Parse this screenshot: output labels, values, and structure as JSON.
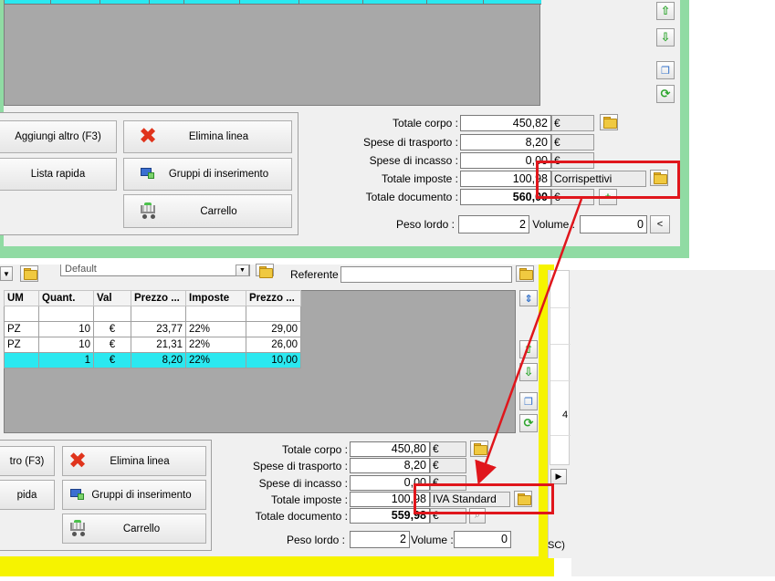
{
  "top": {
    "buttons": {
      "add_other": "Aggiungi altro (F3)",
      "quick_list": "Lista rapida",
      "delete_line": "Elimina linea",
      "insert_groups": "Gruppi di inserimento",
      "cart": "Carrello"
    },
    "totals": {
      "body_label": "Totale corpo :",
      "body_value": "450,82",
      "transport_label": "Spese di trasporto :",
      "transport_value": "8,20",
      "collection_label": "Spese di incasso :",
      "collection_value": "0,00",
      "taxes_label": "Totale imposte :",
      "taxes_value": "100,98",
      "tax_regime": "Corrispettivi",
      "doc_label": "Totale documento :",
      "doc_value": "560,00",
      "currency": "€"
    },
    "weight": {
      "gross_label": "Peso lordo :",
      "gross_value": "2",
      "volume_label": "Volume :",
      "volume_value": "0",
      "less_btn": "<"
    }
  },
  "bottom": {
    "toolbar": {
      "dropdown_value": "Default",
      "referente_label": "Referente"
    },
    "grid": {
      "headers": [
        "UM",
        "Quant.",
        "Val",
        "Prezzo ...",
        "Imposte",
        "Prezzo ..."
      ],
      "rows": [
        [
          "PZ",
          "10",
          "€",
          "23,77",
          "22%",
          "29,00"
        ],
        [
          "PZ",
          "10",
          "€",
          "21,31",
          "22%",
          "26,00"
        ],
        [
          "",
          "1",
          "€",
          "8,20",
          "22%",
          "10,00"
        ]
      ]
    },
    "buttons": {
      "add_other": "tro (F3)",
      "quick_list": "pida",
      "delete_line": "Elimina linea",
      "insert_groups": "Gruppi di inserimento",
      "cart": "Carrello"
    },
    "totals": {
      "body_label": "Totale corpo :",
      "body_value": "450,80",
      "transport_label": "Spese di trasporto :",
      "transport_value": "8,20",
      "collection_label": "Spese di incasso :",
      "collection_value": "0,00",
      "taxes_label": "Totale imposte :",
      "taxes_value": "100,98",
      "tax_regime": "IVA Standard",
      "doc_label": "Totale documento :",
      "doc_value": "559,98",
      "currency": "€"
    },
    "weight": {
      "gross_label": "Peso lordo :",
      "gross_value": "2",
      "volume_label": "Volume :",
      "volume_value": "0"
    },
    "right_panel": {
      "digit": "4",
      "fragment": "SC)"
    }
  },
  "colors": {
    "highlight_red": "#e0161c",
    "top_frame_green": "#90dba3",
    "bottom_frame_yellow": "#f6f300",
    "selected_row_cyan": "#2be8f0"
  }
}
